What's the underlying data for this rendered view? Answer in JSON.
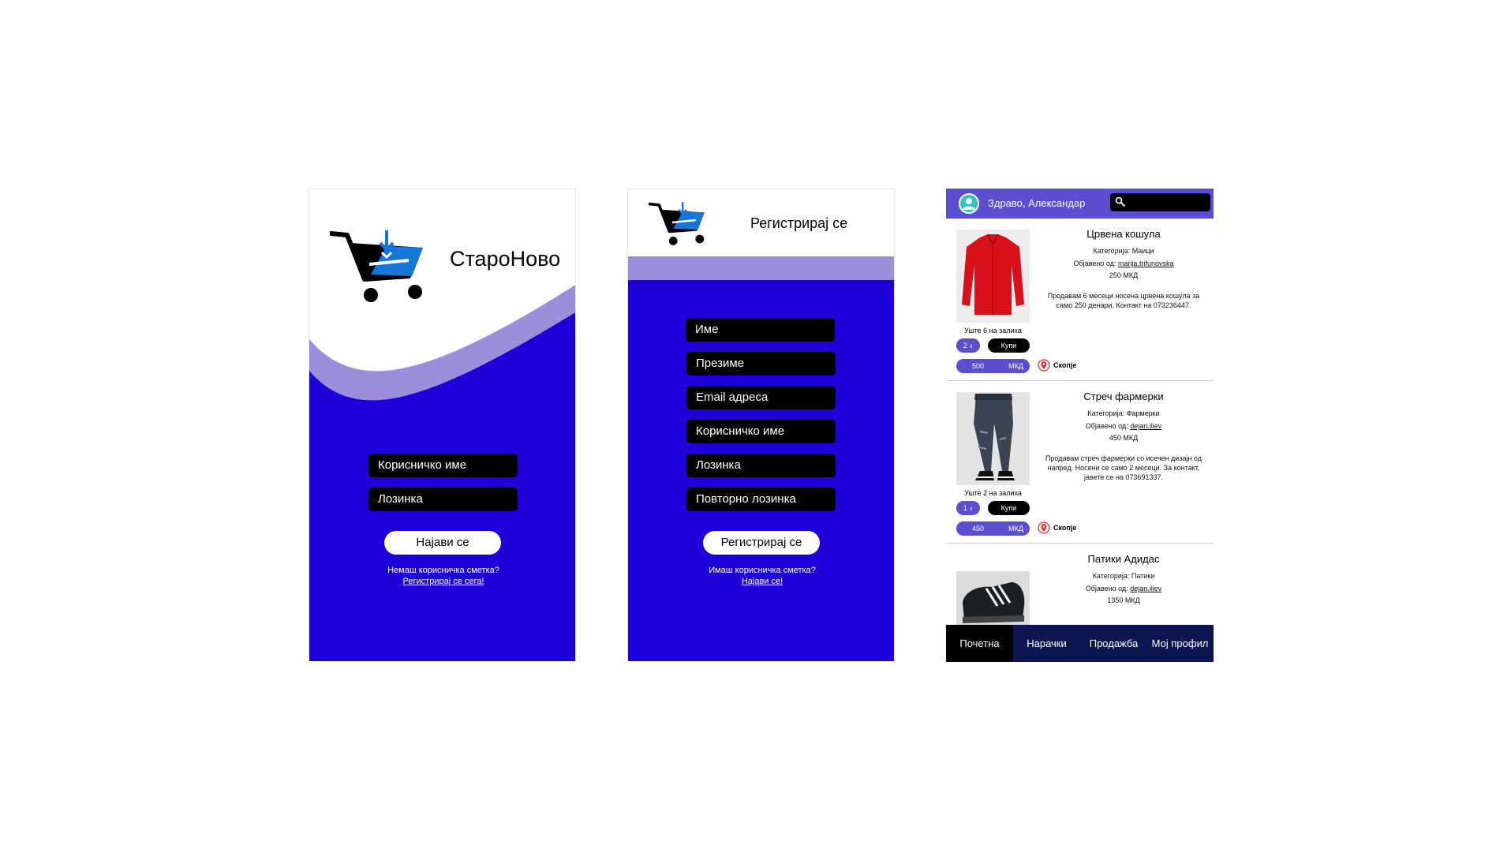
{
  "login": {
    "brand": "СтароНово",
    "username_placeholder": "Корисничко име",
    "password_placeholder": "Лозинка",
    "login_button": "Најави се",
    "no_account": "Немаш корисничка сметка?",
    "register_link": "Регистрирај се сега!",
    "colors": {
      "primary": "#1e00d9",
      "wave": "#9b8fdc"
    }
  },
  "register": {
    "title": "Регистрирај се",
    "fields": [
      "Име",
      "Презиме",
      "Email адреса",
      "Корисничко име",
      "Лозинка",
      "Повторно лозинка"
    ],
    "submit_button": "Регистрирај се",
    "have_account": "Имаш корисничка сметка?",
    "login_link": "Најави се!"
  },
  "home": {
    "greeting": "Здраво, Александар",
    "search_icon": "magnifier-icon",
    "products": [
      {
        "title": "Црвена кошула",
        "category": "Категорија: Маици",
        "posted_by_label": "Објавено од:",
        "posted_by": "marija.trifunovska",
        "price": "250 МКД",
        "description": "Продавам 6 месеци носена црвена кошула за само 250 денари. Контакт на 073236447.",
        "stock": "Уште 6 на залиха",
        "qty": "2",
        "buy_label": "Купи",
        "total_value": "500",
        "total_currency": "МКД",
        "location": "Скопје"
      },
      {
        "title": "Стреч фармерки",
        "category": "Категорија: Фармерки",
        "posted_by_label": "Објавено од:",
        "posted_by": "dejan.iliev",
        "price": "450 МКД",
        "description": "Продавам стреч фармерки со исечен дизајн од напред. Носени се само 2 месеци. За контакт, јавете се на 073691337.",
        "stock": "Уште 2 на залиха",
        "qty": "1",
        "buy_label": "Купи",
        "total_value": "450",
        "total_currency": "МКД",
        "location": "Скопје"
      },
      {
        "title": "Патики Адидас",
        "category": "Категорија: Патики",
        "posted_by_label": "Објавено од:",
        "posted_by": "dejan.iliev",
        "price": "1350 МКД"
      }
    ],
    "nav": [
      "Почетна",
      "Нарачки",
      "Продажба",
      "Мој профил"
    ],
    "nav_active": "Почетна"
  }
}
